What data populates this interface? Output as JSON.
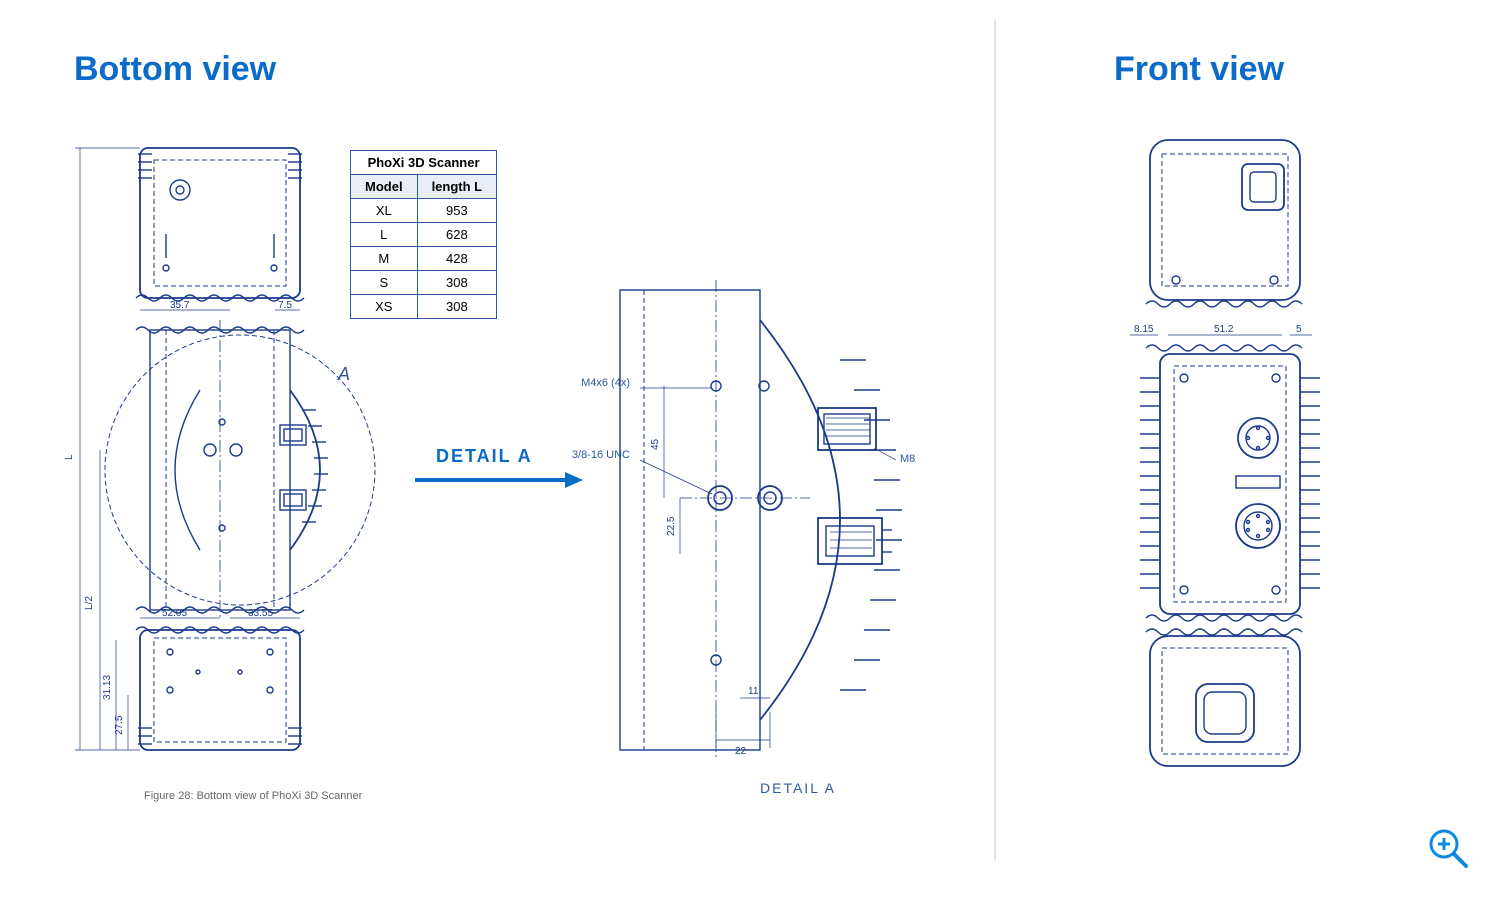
{
  "titles": {
    "bottom": "Bottom view",
    "front": "Front view"
  },
  "caption": "Figure 28: Bottom view of PhoXi 3D Scanner",
  "table": {
    "title": "PhoXi 3D Scanner",
    "headers": {
      "col1": "Model",
      "col2": "length L"
    },
    "rows": [
      {
        "model": "XL",
        "length": "953"
      },
      {
        "model": "L",
        "length": "628"
      },
      {
        "model": "M",
        "length": "428"
      },
      {
        "model": "S",
        "length": "308"
      },
      {
        "model": "XS",
        "length": "308"
      }
    ]
  },
  "detail": {
    "label": "DETAIL A",
    "caption": "DETAIL A",
    "callout": "A"
  },
  "bottom_dims": {
    "dim_35_7": "35.7",
    "dim_7_5": "7.5",
    "dim_52_05": "52.05",
    "dim_33_55": "33.55",
    "dim_L2": "L/2",
    "dim_L": "L",
    "dim_31_13": "31.13",
    "dim_27_5_3": "27.5"
  },
  "detail_labels": {
    "m4x6": "M4x6  (4x)",
    "unc": "3/8-16 UNC",
    "m8": "M8",
    "d45": "45",
    "d225": "22.5",
    "d22": "22",
    "d11": "11"
  },
  "front_dims": {
    "d8_15": "8.15",
    "d51_2": "51.2",
    "d5": "5"
  },
  "zoom": {
    "name": "zoom-icon"
  }
}
